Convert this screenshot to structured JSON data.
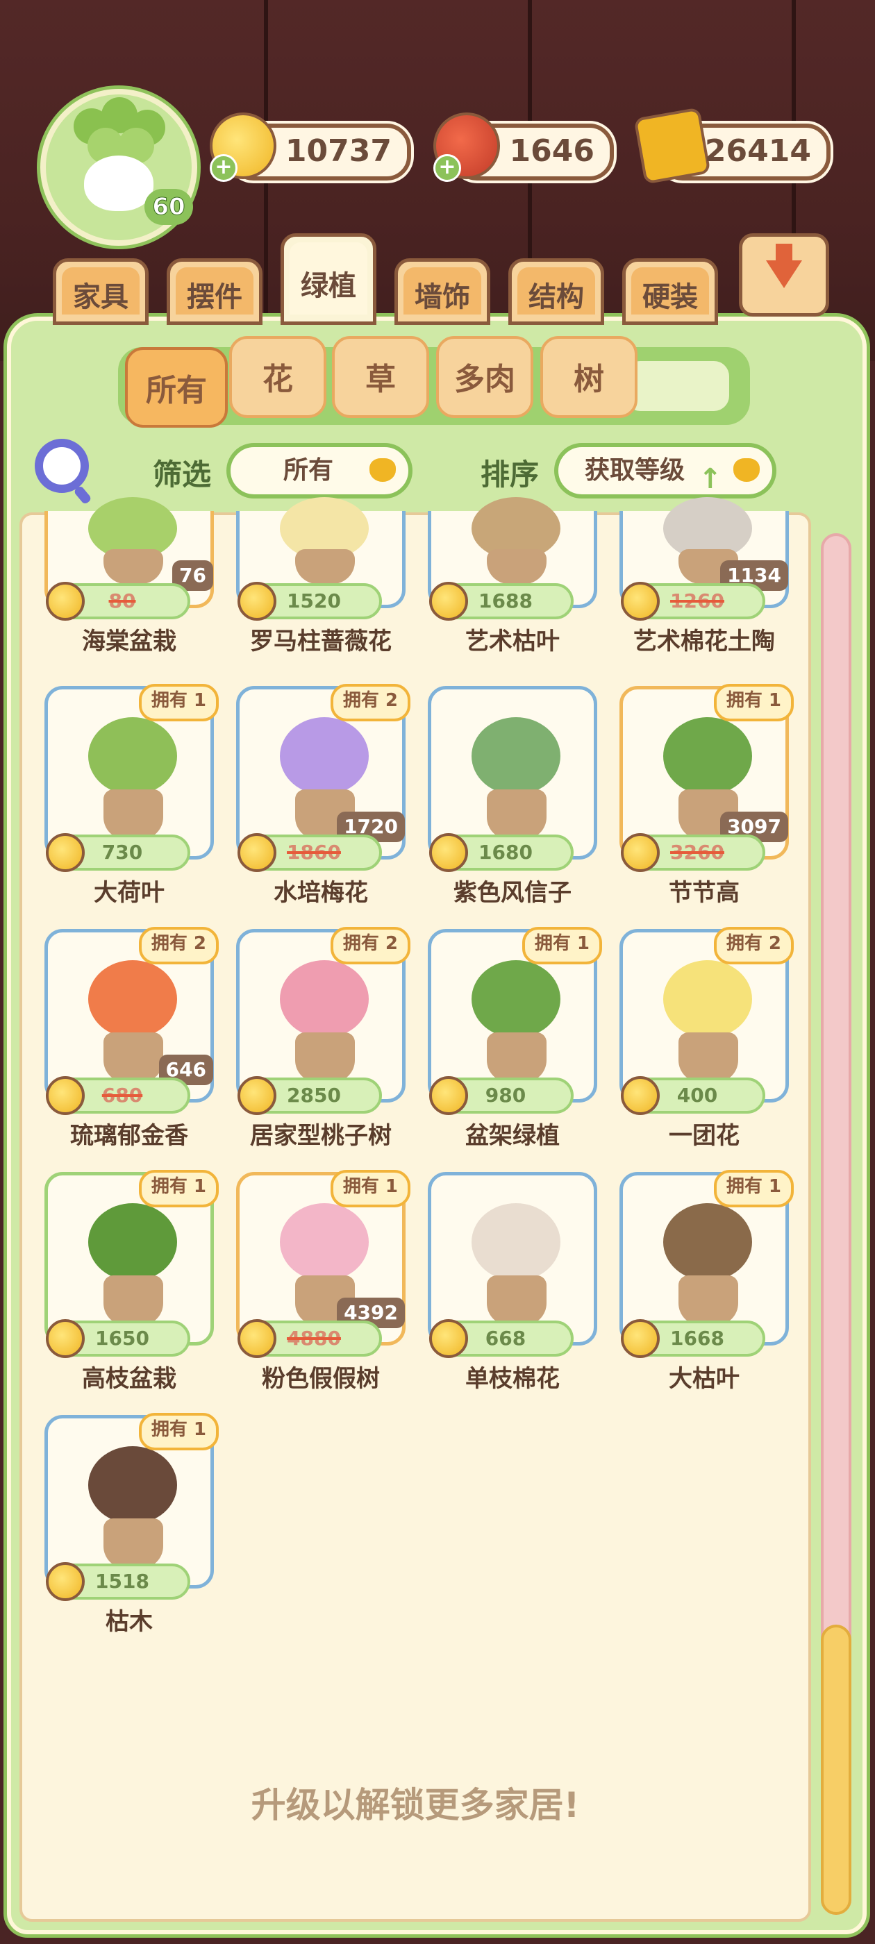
{
  "player": {
    "level": "60"
  },
  "currencies": {
    "coins": "10737",
    "tomatoes": "1646",
    "books": "26414"
  },
  "categories": [
    "家具",
    "摆件",
    "绿植",
    "墙饰",
    "结构",
    "硬装"
  ],
  "active_category": "绿植",
  "subtabs": [
    "所有",
    "花",
    "草",
    "多肉",
    "树"
  ],
  "active_subtab": "所有",
  "filter": {
    "label": "筛选",
    "value": "所有"
  },
  "sort": {
    "label": "排序",
    "value": "获取等级"
  },
  "items": [
    {
      "name": "海棠盆栽",
      "price": "80",
      "sale": "76",
      "strike": true,
      "owned": ""
    },
    {
      "name": "罗马柱蔷薇花",
      "price": "1520",
      "sale": "",
      "strike": false,
      "owned": ""
    },
    {
      "name": "艺术枯叶",
      "price": "1688",
      "sale": "",
      "strike": false,
      "owned": ""
    },
    {
      "name": "艺术棉花土陶",
      "price": "1260",
      "sale": "1134",
      "strike": true,
      "owned": ""
    },
    {
      "name": "大荷叶",
      "price": "730",
      "sale": "",
      "strike": false,
      "owned": "拥有 1"
    },
    {
      "name": "水培梅花",
      "price": "1860",
      "sale": "1720",
      "strike": true,
      "owned": "拥有 2"
    },
    {
      "name": "紫色风信子",
      "price": "1680",
      "sale": "",
      "strike": false,
      "owned": ""
    },
    {
      "name": "节节高",
      "price": "3260",
      "sale": "3097",
      "strike": true,
      "owned": "拥有 1"
    },
    {
      "name": "琉璃郁金香",
      "price": "680",
      "sale": "646",
      "strike": true,
      "owned": "拥有 2"
    },
    {
      "name": "居家型桃子树",
      "price": "2850",
      "sale": "",
      "strike": false,
      "owned": "拥有 2"
    },
    {
      "name": "盆架绿植",
      "price": "980",
      "sale": "",
      "strike": false,
      "owned": "拥有 1"
    },
    {
      "name": "一团花",
      "price": "400",
      "sale": "",
      "strike": false,
      "owned": "拥有 2"
    },
    {
      "name": "高枝盆栽",
      "price": "1650",
      "sale": "",
      "strike": false,
      "owned": "拥有 1"
    },
    {
      "name": "粉色假假树",
      "price": "4880",
      "sale": "4392",
      "strike": true,
      "owned": "拥有 1"
    },
    {
      "name": "单枝棉花",
      "price": "668",
      "sale": "",
      "strike": false,
      "owned": ""
    },
    {
      "name": "大枯叶",
      "price": "1668",
      "sale": "",
      "strike": false,
      "owned": "拥有 1"
    },
    {
      "name": "枯木",
      "price": "1518",
      "sale": "",
      "strike": false,
      "owned": "拥有 1"
    }
  ],
  "footer": "升级以解锁更多家居!",
  "colors": {
    "panel": "#cfe9a6",
    "accent": "#f6b760",
    "coin": "#f0b524",
    "sale_badge": "#8a6a55"
  }
}
